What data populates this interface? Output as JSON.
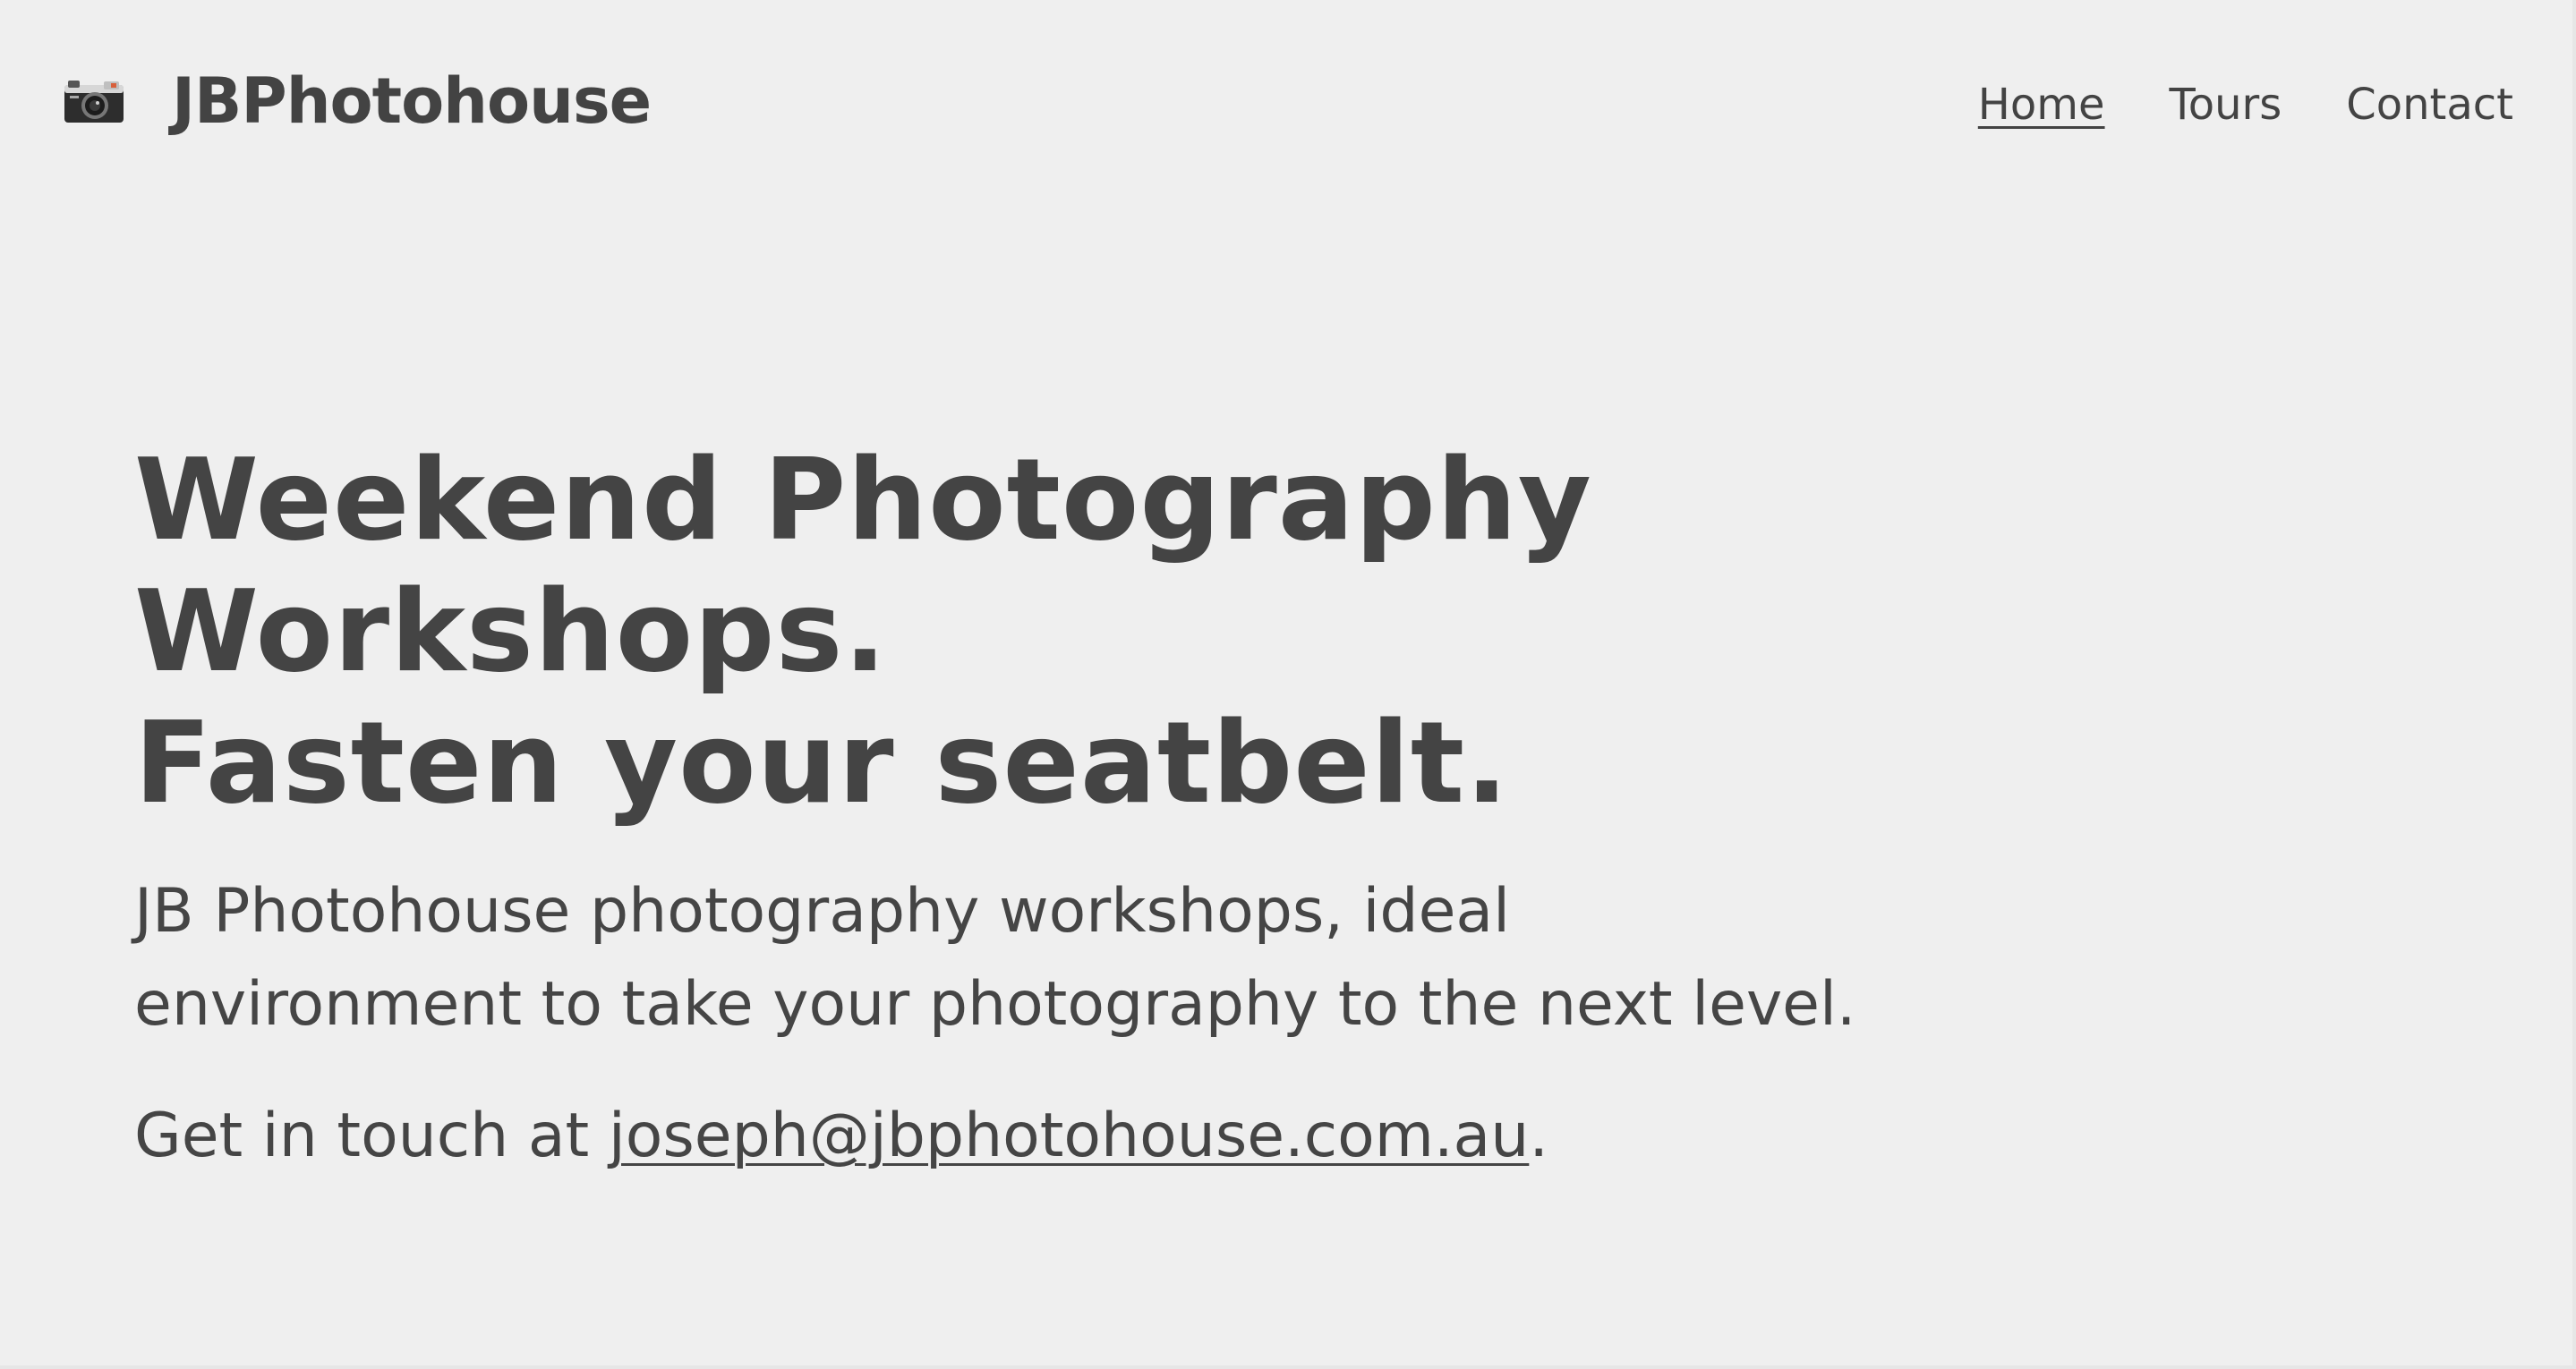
{
  "header": {
    "brand_name": "JBPhotohouse",
    "logo_icon": "camera-icon",
    "nav": [
      {
        "label": "Home",
        "active": true
      },
      {
        "label": "Tours",
        "active": false
      },
      {
        "label": "Contact",
        "active": false
      }
    ]
  },
  "hero": {
    "title_line_1": "Weekend Photography",
    "title_line_2": "Workshops.",
    "title_line_3": "Fasten your seatbelt.",
    "intro": "JB Photohouse photography workshops, ideal environment to take your photography to the next level.",
    "contact_prefix": "Get in touch at ",
    "email": "joseph@jbphotohouse.com.au",
    "contact_suffix": "."
  },
  "colors": {
    "background": "#efefef",
    "text": "#434343"
  }
}
